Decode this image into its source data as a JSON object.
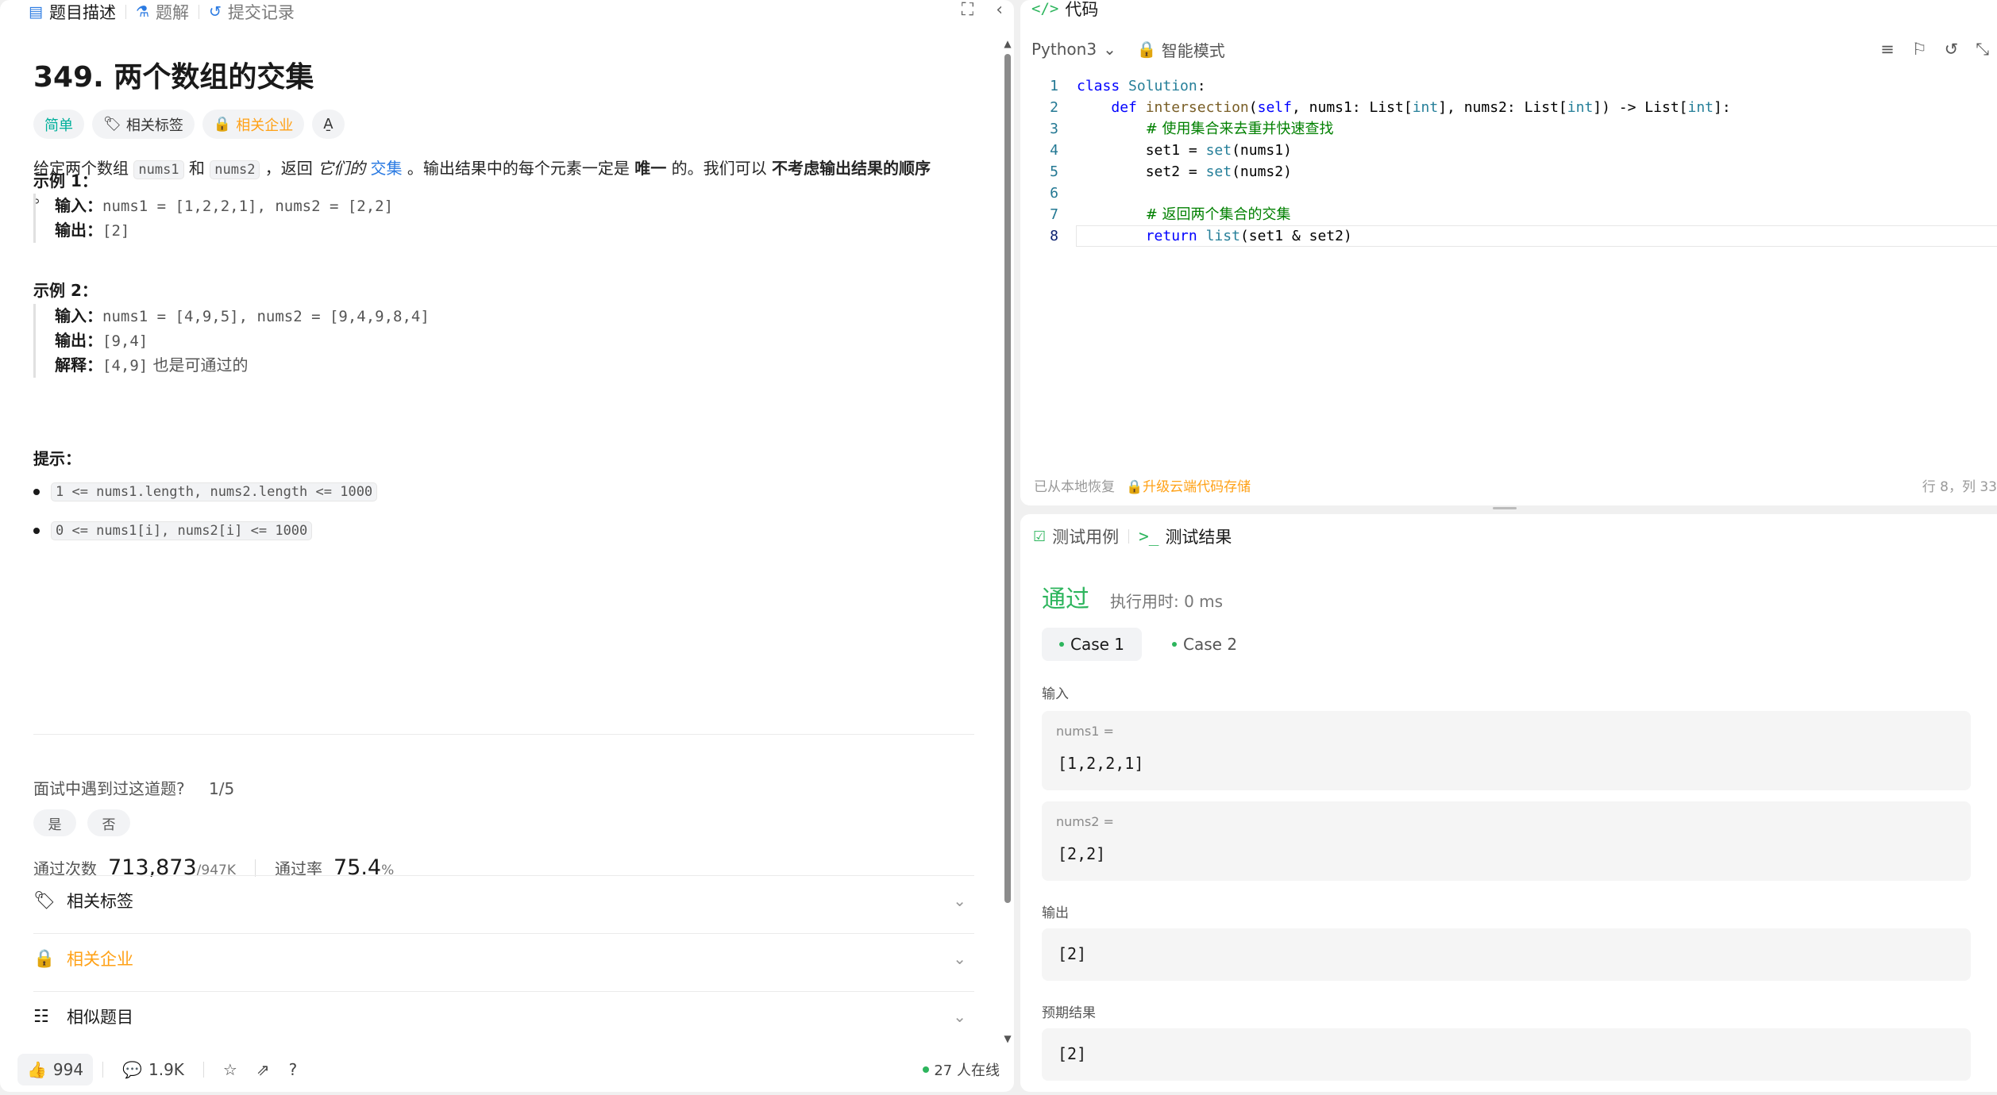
{
  "left_tabs": [
    {
      "label": "题目描述",
      "icon": "description-icon",
      "active": true
    },
    {
      "label": "题解",
      "icon": "flask-icon",
      "active": false
    },
    {
      "label": "提交记录",
      "icon": "history-icon",
      "active": false
    }
  ],
  "problem": {
    "title": "349. 两个数组的交集",
    "badges": {
      "difficulty": "简单",
      "tags": "相关标签",
      "companies": "相关企业",
      "translate": "A̱"
    },
    "desc": {
      "p1": "给定两个数组 ",
      "code1": "nums1",
      "p2": " 和 ",
      "code2": "nums2",
      "p3": " ，返回 ",
      "em": "它们的",
      "link": "交集",
      "p4": " 。输出结果中的每个元素一定是 ",
      "b1": "唯一",
      "p5": " 的。我们可以 ",
      "b2": "不考虑输出结果的顺序",
      "p6": "。"
    },
    "examples": [
      {
        "title": "示例 1：",
        "input_label": "输入：",
        "input": "nums1 = [1,2,2,1], nums2 = [2,2]",
        "output_label": "输出：",
        "output": "[2]"
      },
      {
        "title": "示例 2：",
        "input_label": "输入：",
        "input": "nums1 = [4,9,5], nums2 = [9,4,9,8,4]",
        "output_label": "输出：",
        "output": "[9,4]",
        "explain_label": "解释：",
        "explain_code": "[4,9]",
        "explain_text": " 也是可通过的"
      }
    ],
    "hints_title": "提示：",
    "hints": [
      "1 <= nums1.length, nums2.length <= 1000",
      "0 <= nums1[i], nums2[i] <= 1000"
    ],
    "interview": {
      "question": "面试中遇到过这道题?",
      "count": "1/5",
      "yes": "是",
      "no": "否"
    },
    "stats": {
      "accepted_label": "通过次数",
      "accepted": "713,873",
      "submissions": "/947K",
      "rate_label": "通过率",
      "rate": "75.4",
      "rate_unit": "%"
    },
    "accordions": {
      "tags": "相关标签",
      "companies": "相关企业",
      "similar": "相似题目"
    }
  },
  "footer": {
    "likes": "994",
    "comments": "1.9K",
    "online": "27 人在线"
  },
  "code": {
    "header": "代码",
    "language": "Python3",
    "mode": "智能模式",
    "status_restore": "已从本地恢复",
    "status_upgrade": "升级云端代码存储",
    "cursor_pos": "行 8，列 33",
    "line_numbers": [
      "1",
      "2",
      "3",
      "4",
      "5",
      "6",
      "7",
      "8"
    ]
  },
  "results": {
    "tab_testcase": "测试用例",
    "tab_result": "测试结果",
    "verdict": "通过",
    "runtime": "执行用时: 0 ms",
    "cases": [
      "Case 1",
      "Case 2"
    ],
    "input_label": "输入",
    "vars": [
      {
        "name": "nums1 =",
        "value": "[1,2,2,1]"
      },
      {
        "name": "nums2 =",
        "value": "[2,2]"
      }
    ],
    "output_label": "输出",
    "output": "[2]",
    "expected_label": "预期结果",
    "expected": "[2]"
  },
  "colors": {
    "accent_green": "#2db55d",
    "easy": "#00af9b",
    "company_orange": "#ffa116",
    "link_blue": "#2a7ae2"
  }
}
